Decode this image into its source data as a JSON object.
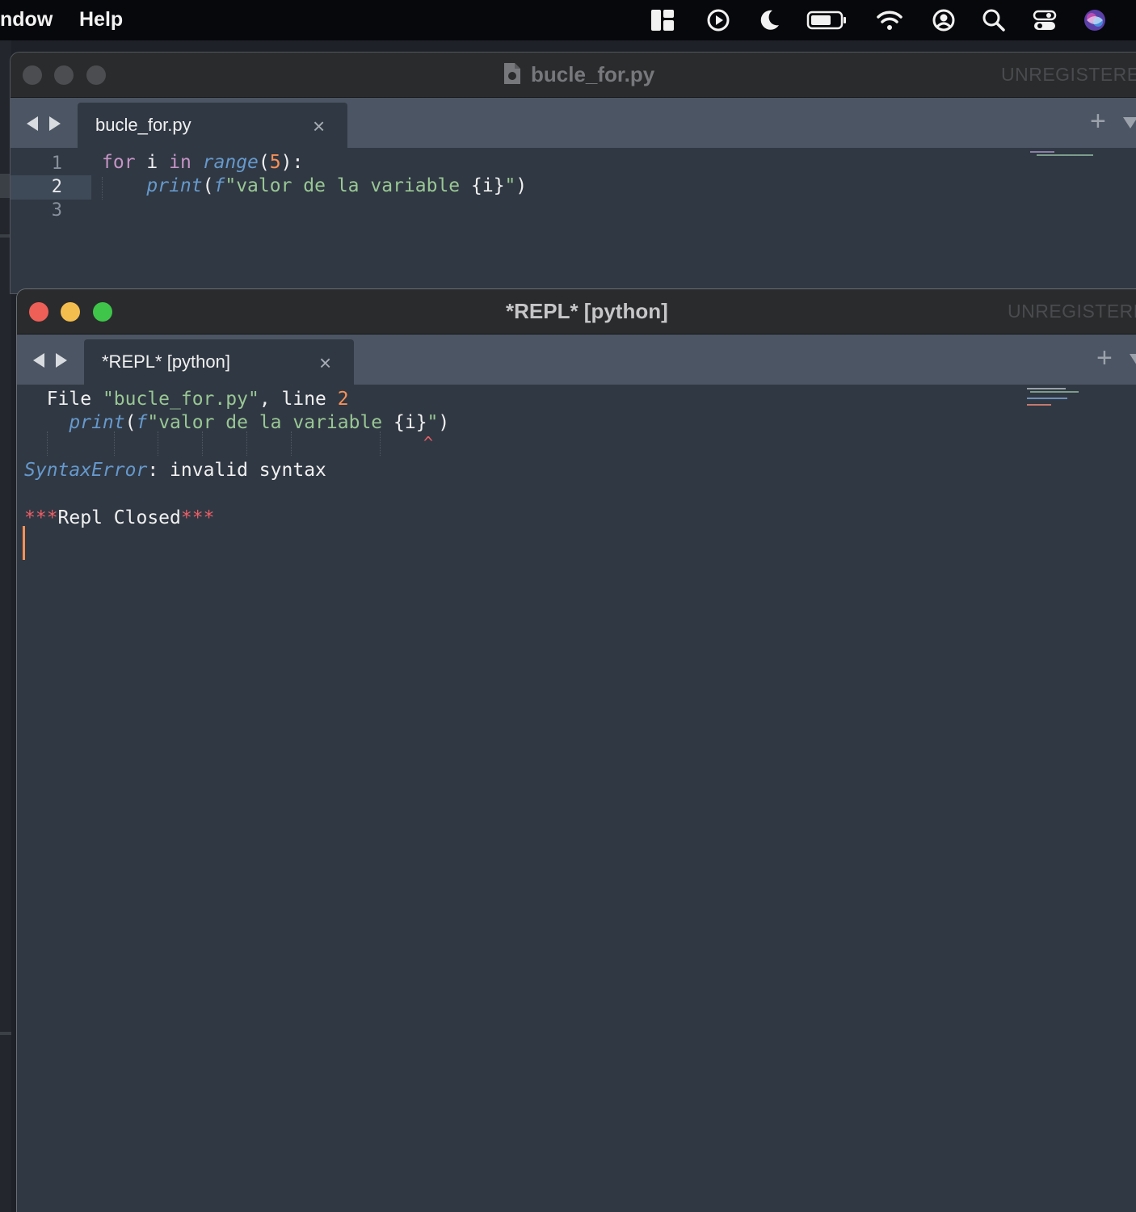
{
  "menubar": {
    "menu_items": [
      "ndow",
      "Help"
    ],
    "status_icons": [
      "layout-icon",
      "play-circle-icon",
      "moon-icon",
      "battery-icon",
      "wifi-icon",
      "user-circle-icon",
      "search-icon",
      "control-center-icon",
      "siri-icon"
    ]
  },
  "editor_window": {
    "title": "bucle_for.py",
    "unregistered": "UNREGISTERED",
    "tab": {
      "label": "bucle_for.py",
      "close": "×"
    },
    "new_tab": "+",
    "line_numbers": [
      "1",
      "2",
      "3"
    ],
    "code": {
      "l1_kw1": "for",
      "l1_var": " i ",
      "l1_kw2": "in",
      "l1_fn": "range",
      "l1_open": "(",
      "l1_num": "5",
      "l1_close": "):",
      "l2_indent": "    ",
      "l2_fn": "print",
      "l2_open": "(",
      "l2_prefix": "f",
      "l2_str_a": "\"valor de la variable ",
      "l2_interp": "{i}",
      "l2_str_b": "\"",
      "l2_close": ")"
    }
  },
  "repl_window": {
    "title": "*REPL* [python]",
    "unregistered": "UNREGISTERED",
    "tab": {
      "label": "*REPL* [python]",
      "close": "×"
    },
    "new_tab": "+",
    "output": {
      "file_word": "  File ",
      "file_name": "\"bucle_for.py\"",
      "line_text": ", line ",
      "line_num": "2",
      "p_indent": "    ",
      "p_fn": "print",
      "p_open": "(",
      "p_prefix": "f",
      "p_str_a": "\"valor de la variable ",
      "p_interp": "{i}",
      "p_str_b": "\"",
      "p_close": ")",
      "caret": "^",
      "error_type": "SyntaxError",
      "error_msg": ": invalid syntax",
      "stars_left": "***",
      "closed_text": "Repl Closed",
      "stars_right": "***"
    }
  },
  "colors": {
    "editor_bg": "#303843",
    "tabbar_bg": "#4c5563",
    "keyword": "#c594c5",
    "function": "#6699cc",
    "number": "#f99157",
    "string": "#99c794",
    "error_star": "#ec5f67"
  }
}
